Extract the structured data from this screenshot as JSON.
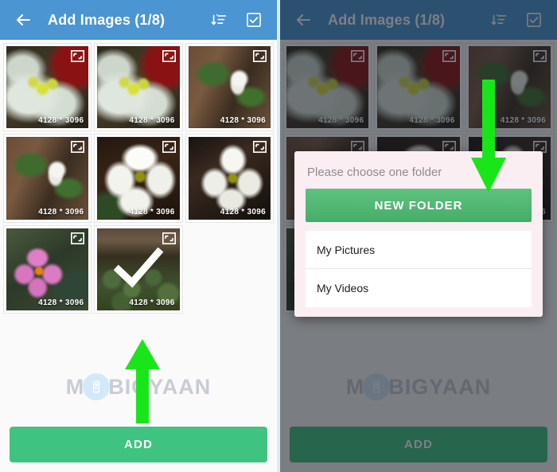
{
  "app": {
    "header": {
      "back_icon": "back-arrow-icon",
      "title": "Add Images (1/8)",
      "sort_icon": "sort-descending-icon",
      "select_all_icon": "checkbox-checked-icon"
    },
    "bottom": {
      "add_label": "ADD"
    },
    "watermark": {
      "text_before": "M",
      "badge_icon": "mobile-phone-icon",
      "text_after": "BIGYAAN"
    },
    "grid": {
      "resolution_label": "4128 * 3096",
      "expand_icon": "expand-fullscreen-icon",
      "check_icon": "checkmark-icon",
      "items": [
        {
          "id": "image-1",
          "art": "p-bud",
          "resolution": "4128 * 3096",
          "selected": false
        },
        {
          "id": "image-2",
          "art": "p-bud",
          "resolution": "4128 * 3096",
          "selected": false
        },
        {
          "id": "image-3",
          "art": "p-whiteflower-small",
          "resolution": "4128 * 3096",
          "selected": false
        },
        {
          "id": "image-4",
          "art": "p-whiteflower-small",
          "resolution": "4128 * 3096",
          "selected": false
        },
        {
          "id": "image-5",
          "art": "p-whiteflower-big",
          "resolution": "4128 * 3096",
          "selected": false
        },
        {
          "id": "image-6",
          "art": "p-whiteflower-dark",
          "resolution": "4128 * 3096",
          "selected": false
        },
        {
          "id": "image-7",
          "art": "p-pink",
          "resolution": "4128 * 3096",
          "selected": false
        },
        {
          "id": "image-8",
          "art": "p-leaves",
          "resolution": "4128 * 3096",
          "selected": true
        }
      ]
    }
  },
  "dialog": {
    "title": "Please choose one folder",
    "new_folder_label": "NEW FOLDER",
    "folders": [
      {
        "label": "My Pictures"
      },
      {
        "label": "My Videos"
      }
    ]
  },
  "annotations": {
    "arrow_up": "green-arrow-up",
    "arrow_down": "green-arrow-down"
  },
  "colors": {
    "appbar_blue": "#4a95d2",
    "accent_green": "#3fc380",
    "dialog_button_green": "#46ad68",
    "annotation_green": "#19e619",
    "dialog_bg": "#fbeef2"
  }
}
